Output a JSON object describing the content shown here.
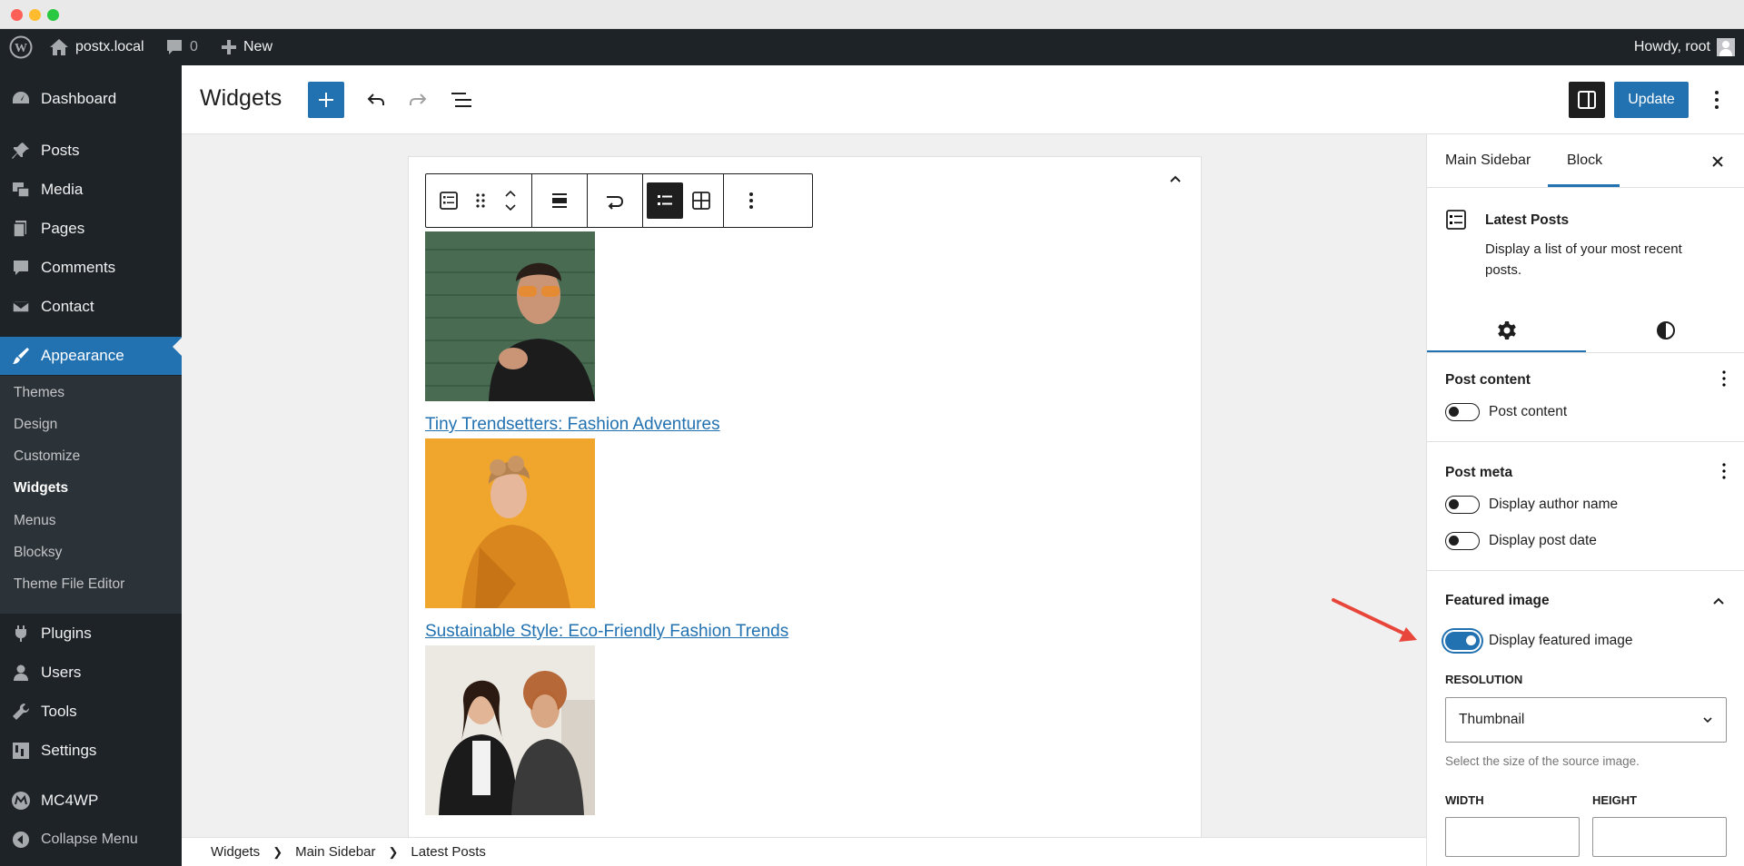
{
  "adminbar": {
    "site_name": "postx.local",
    "comments_count": "0",
    "new_label": "New",
    "howdy": "Howdy, root"
  },
  "sidebar": {
    "items": [
      {
        "label": "Dashboard",
        "icon": "dashboard-icon"
      },
      {
        "label": "Posts",
        "icon": "pin-icon"
      },
      {
        "label": "Media",
        "icon": "media-icon"
      },
      {
        "label": "Pages",
        "icon": "pages-icon"
      },
      {
        "label": "Comments",
        "icon": "comment-icon"
      },
      {
        "label": "Contact",
        "icon": "mail-icon"
      },
      {
        "label": "Appearance",
        "icon": "brush-icon"
      },
      {
        "label": "Plugins",
        "icon": "plug-icon"
      },
      {
        "label": "Users",
        "icon": "user-icon"
      },
      {
        "label": "Tools",
        "icon": "wrench-icon"
      },
      {
        "label": "Settings",
        "icon": "settings-icon"
      },
      {
        "label": "MC4WP",
        "icon": "mc4wp-icon"
      },
      {
        "label": "Collapse Menu",
        "icon": "collapse-icon"
      }
    ],
    "submenu": [
      "Themes",
      "Design",
      "Customize",
      "Widgets",
      "Menus",
      "Blocksy",
      "Theme File Editor"
    ],
    "current_sub": "Widgets"
  },
  "header": {
    "title": "Widgets",
    "update_label": "Update"
  },
  "posts": [
    {
      "title": "Tiny Trendsetters: Fashion Adventures"
    },
    {
      "title": "Sustainable Style: Eco-Friendly Fashion Trends"
    }
  ],
  "panel": {
    "tabs": [
      "Main Sidebar",
      "Block"
    ],
    "active_tab": "Block",
    "block_name": "Latest Posts",
    "block_desc": "Display a list of your most recent posts.",
    "post_content": {
      "title": "Post content",
      "toggle_label": "Post content",
      "on": false
    },
    "post_meta": {
      "title": "Post meta",
      "author_label": "Display author name",
      "date_label": "Display post date"
    },
    "featured": {
      "title": "Featured image",
      "toggle_label": "Display featured image",
      "on": true,
      "resolution_label": "RESOLUTION",
      "resolution_value": "Thumbnail",
      "resolution_help": "Select the size of the source image.",
      "width_label": "WIDTH",
      "height_label": "HEIGHT"
    }
  },
  "breadcrumb": [
    "Widgets",
    "Main Sidebar",
    "Latest Posts"
  ],
  "colors": {
    "accent": "#2271b1",
    "admin_dark": "#1d2327",
    "annotation_arrow": "#e8463a"
  }
}
